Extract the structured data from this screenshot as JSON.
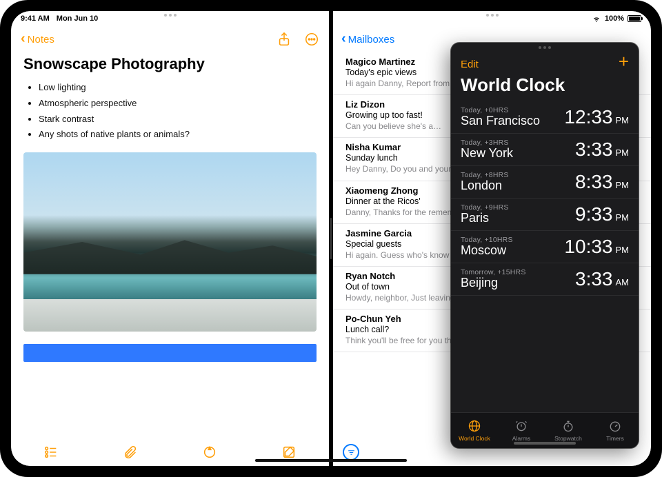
{
  "statusbar": {
    "time": "9:41 AM",
    "date": "Mon Jun 10",
    "battery_pct": "100%"
  },
  "notes": {
    "back_label": "Notes",
    "title": "Snowscape Photography",
    "bullets": [
      "Low lighting",
      "Atmospheric perspective",
      "Stark contrast",
      "Any shots of native plants or animals?"
    ]
  },
  "mail": {
    "back_label": "Mailboxes",
    "items": [
      {
        "sender": "Magico Martinez",
        "subject": "Today's epic views",
        "preview": "Hi again Danny, Report from the field: Wide open skies, a ge…"
      },
      {
        "sender": "Liz Dizon",
        "subject": "Growing up too fast!",
        "preview": "Can you believe she's a…"
      },
      {
        "sender": "Nisha Kumar",
        "subject": "Sunday lunch",
        "preview": "Hey Danny, Do you and your dad? If you two join, th…"
      },
      {
        "sender": "Xiaomeng Zhong",
        "subject": "Dinner at the Ricos'",
        "preview": "Danny, Thanks for the remembered to take o…"
      },
      {
        "sender": "Jasmine Garcia",
        "subject": "Special guests",
        "preview": "Hi again. Guess who's know how to make me…"
      },
      {
        "sender": "Ryan Notch",
        "subject": "Out of town",
        "preview": "Howdy, neighbor, Just leaving Tuesday and w…"
      },
      {
        "sender": "Po-Chun Yeh",
        "subject": "Lunch call?",
        "preview": "Think you'll be free for you think might work a…"
      }
    ]
  },
  "clock": {
    "edit_label": "Edit",
    "title": "World Clock",
    "rows": [
      {
        "meta": "Today, +0HRS",
        "city": "San Francisco",
        "time": "12:33",
        "ampm": "PM"
      },
      {
        "meta": "Today, +3HRS",
        "city": "New York",
        "time": "3:33",
        "ampm": "PM"
      },
      {
        "meta": "Today, +8HRS",
        "city": "London",
        "time": "8:33",
        "ampm": "PM"
      },
      {
        "meta": "Today, +9HRS",
        "city": "Paris",
        "time": "9:33",
        "ampm": "PM"
      },
      {
        "meta": "Today, +10HRS",
        "city": "Moscow",
        "time": "10:33",
        "ampm": "PM"
      },
      {
        "meta": "Tomorrow, +15HRS",
        "city": "Beijing",
        "time": "3:33",
        "ampm": "AM"
      }
    ],
    "tabs": {
      "world_clock": "World Clock",
      "alarms": "Alarms",
      "stopwatch": "Stopwatch",
      "timers": "Timers"
    }
  }
}
